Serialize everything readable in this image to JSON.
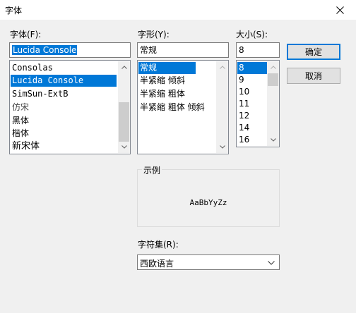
{
  "window": {
    "title": "字体"
  },
  "font": {
    "label": "字体(F):",
    "value": "Lucida Console",
    "items": [
      {
        "label": "Consolas",
        "selected": false
      },
      {
        "label": "Lucida Console",
        "selected": true
      },
      {
        "label": "SimSun-ExtB",
        "selected": false
      },
      {
        "label": "仿宋",
        "selected": false
      },
      {
        "label": "黑体",
        "selected": false
      },
      {
        "label": "楷体",
        "selected": false
      },
      {
        "label": "新宋体",
        "selected": false
      }
    ]
  },
  "style": {
    "label": "字形(Y):",
    "value": "常规",
    "items": [
      {
        "label": "常规",
        "selected": true
      },
      {
        "label": "半紧缩 倾斜",
        "selected": false
      },
      {
        "label": "半紧缩 粗体",
        "selected": false
      },
      {
        "label": "半紧缩 粗体 倾斜",
        "selected": false
      }
    ]
  },
  "size": {
    "label": "大小(S):",
    "value": "8",
    "items": [
      {
        "label": "8",
        "selected": true
      },
      {
        "label": "9",
        "selected": false
      },
      {
        "label": "10",
        "selected": false
      },
      {
        "label": "11",
        "selected": false
      },
      {
        "label": "12",
        "selected": false
      },
      {
        "label": "14",
        "selected": false
      },
      {
        "label": "16",
        "selected": false
      }
    ]
  },
  "buttons": {
    "ok": "确定",
    "cancel": "取消"
  },
  "sample": {
    "label": "示例",
    "text": "AaBbYyZz"
  },
  "script": {
    "label": "字符集(R):",
    "value": "西欧语言"
  },
  "colors": {
    "selection": "#0078d7",
    "default_button_border": "#0078d7"
  },
  "icons": {
    "close": "close-icon",
    "scroll_up": "chevron-up-icon",
    "scroll_down": "chevron-down-icon",
    "dropdown": "chevron-down-icon"
  }
}
